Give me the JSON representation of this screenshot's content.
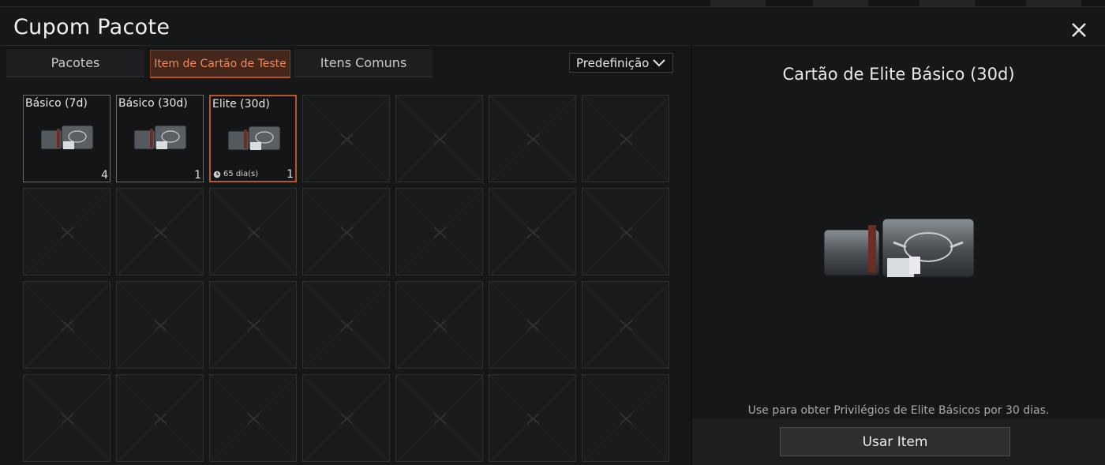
{
  "window": {
    "title": "Cupom Pacote"
  },
  "tabs": [
    {
      "label": "Pacotes",
      "active": false
    },
    {
      "label": "Item de Cartão de Teste",
      "active": true
    },
    {
      "label": "Itens Comuns",
      "active": false
    }
  ],
  "sort": {
    "selected": "Predefinição"
  },
  "inventory": {
    "items": [
      {
        "name": "Básico (7d)",
        "quantity": "4",
        "timer": ""
      },
      {
        "name": "Básico (30d)",
        "quantity": "1",
        "timer": ""
      },
      {
        "name": "Elite (30d)",
        "quantity": "1",
        "timer": "65 dia(s)",
        "selected": true
      }
    ]
  },
  "detail": {
    "title": "Cartão de Elite Básico (30d)",
    "description": "Use para obter Privilégios de Elite Básicos por 30 dias.",
    "use_button": "Usar Item"
  },
  "colors": {
    "accent": "#b35a2c",
    "accent_text": "#ef8a5b",
    "panel": "#161718"
  },
  "icons": {
    "close": "close-icon",
    "dropdown": "chevron-down-icon",
    "item_thumb": "elite-crate-icon",
    "timer": "clock-icon",
    "empty_slot": "empty-slot-icon"
  }
}
